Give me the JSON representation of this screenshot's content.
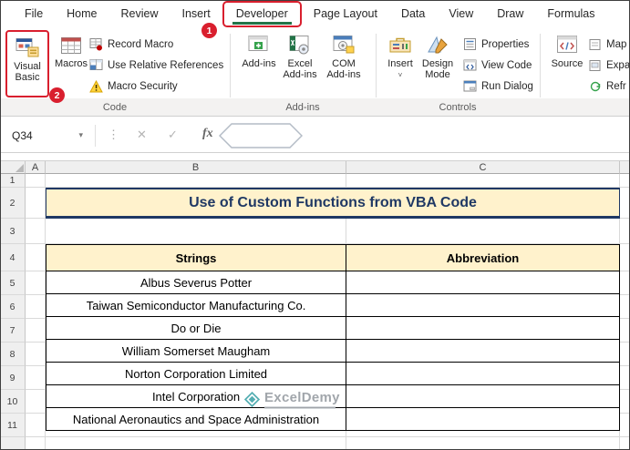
{
  "ribbon": {
    "tabs": [
      "File",
      "Home",
      "Review",
      "Insert",
      "Developer",
      "Page Layout",
      "Data",
      "View",
      "Draw",
      "Formulas"
    ],
    "active_tab": "Developer",
    "badge_1": "1",
    "badge_2": "2",
    "code_group": {
      "label": "Code",
      "buttons": {
        "visual_basic": "Visual Basic",
        "macros": "Macros",
        "record_macro": "Record Macro",
        "use_relative_references": "Use Relative References",
        "macro_security": "Macro Security"
      }
    },
    "addins_group": {
      "label": "Add-ins",
      "buttons": {
        "addins": "Add-ins",
        "excel_addins": "Excel Add-ins",
        "com_addins": "COM Add-ins"
      }
    },
    "controls_group": {
      "label": "Controls",
      "buttons": {
        "insert": "Insert",
        "design_mode": "Design Mode",
        "properties": "Properties",
        "view_code": "View Code",
        "run_dialog": "Run Dialog"
      }
    },
    "xml_group": {
      "buttons": {
        "source": "Source",
        "map": "Map",
        "expansion": "Expa",
        "refresh": "Refr"
      }
    }
  },
  "formula_bar": {
    "name_box": "Q34",
    "fx": "fx",
    "cancel": "✕",
    "enter": "✓"
  },
  "icons": {
    "name_box_chevron": "▾",
    "more_dots": "⋮",
    "insert_dropdown": "˅"
  },
  "sheet": {
    "column_headers": [
      "A",
      "B",
      "C"
    ],
    "row_numbers": [
      "1",
      "2",
      "3",
      "4",
      "5",
      "6",
      "7",
      "8",
      "9",
      "10",
      "11"
    ],
    "title": "Use of Custom Functions from VBA Code",
    "table": {
      "headers": [
        "Strings",
        "Abbreviation"
      ],
      "rows": [
        "Albus Severus Potter",
        "Taiwan Semiconductor Manufacturing Co.",
        "Do or Die",
        "William Somerset Maugham",
        "Norton Corporation Limited",
        "Intel Corporation",
        "National Aeronautics and Space Administration"
      ]
    },
    "watermark": "ExcelDemy"
  },
  "colors": {
    "annotation_red": "#d91f2e",
    "active_tab_green": "#217346",
    "header_fill": "#fff2cc",
    "title_text": "#1f3864",
    "table_border": "#000000"
  }
}
